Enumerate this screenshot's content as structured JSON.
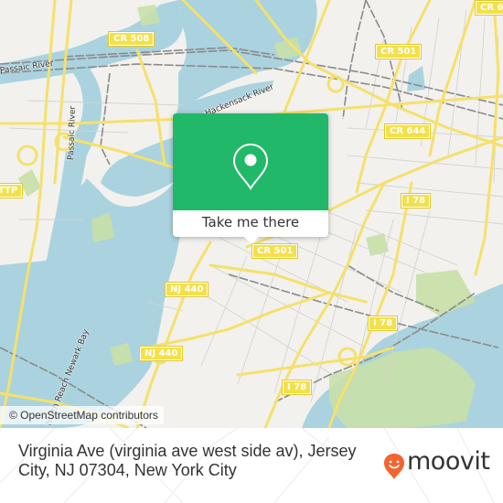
{
  "map": {
    "attribution": "© OpenStreetMap contributors",
    "colors": {
      "land": "#f2f1ee",
      "water": "#aad3df",
      "park": "#c8e0a8",
      "road_major": "#f5e16a",
      "road_minor": "#cfcfcf",
      "rail": "#888888"
    },
    "shields": [
      {
        "id": "cr508",
        "label": "CR 508"
      },
      {
        "id": "cr501-north",
        "label": "CR 501"
      },
      {
        "id": "cr644",
        "label": "CR 644"
      },
      {
        "id": "cr6-top",
        "label": "CR 6"
      },
      {
        "id": "i78-north",
        "label": "I 78"
      },
      {
        "id": "cr501-south",
        "label": "CR 501"
      },
      {
        "id": "nj440-north",
        "label": "NJ 440"
      },
      {
        "id": "i78-east",
        "label": "I 78"
      },
      {
        "id": "nj440-south",
        "label": "NJ 440"
      },
      {
        "id": "i78-south",
        "label": "I 78"
      },
      {
        "id": "ttp-left",
        "label": "TTP"
      }
    ],
    "water_labels": [
      {
        "id": "passaic-river-north",
        "label": "Passaic River"
      },
      {
        "id": "passaic-river",
        "label": "Passaic River"
      },
      {
        "id": "hackensack-river",
        "label": "Hackensack River"
      },
      {
        "id": "newark-bay",
        "label": "North Reach Newark Bay"
      }
    ]
  },
  "popup": {
    "button_label": "Take me there",
    "pin_icon": "location-pin",
    "accent_color": "#21b869"
  },
  "footer": {
    "address": "Virginia Ave (virginia ave west side av), Jersey City, NJ 07304, New York City",
    "brand": "moovit",
    "brand_color": "#f26430"
  }
}
